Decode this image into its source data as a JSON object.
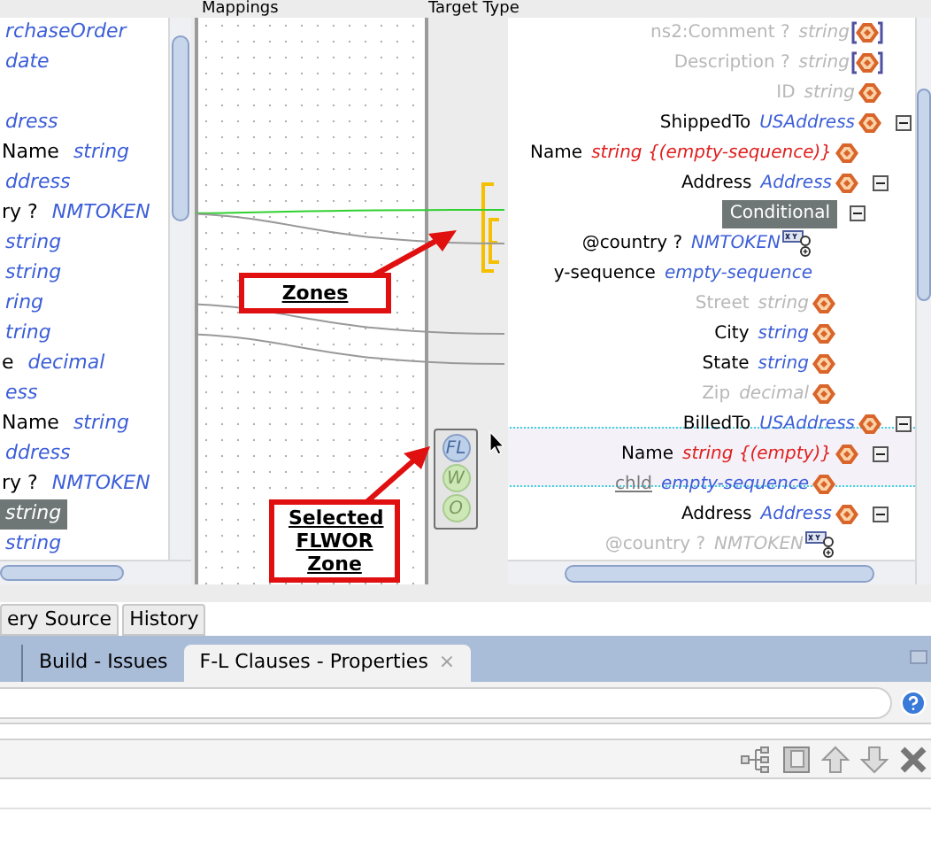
{
  "headers": {
    "mappings": "Mappings",
    "target": "Target Type"
  },
  "source_tree": [
    {
      "kind": "node",
      "type": "rchaseOrder",
      "selected": false
    },
    {
      "kind": "node",
      "type": "date",
      "selected": false
    },
    {
      "kind": "blank"
    },
    {
      "type": "dress",
      "selected": false
    },
    {
      "name": "Name",
      "type": "string",
      "selected": false
    },
    {
      "type": "ddress",
      "selected": false
    },
    {
      "name": "ry ?",
      "type": "NMTOKEN",
      "selected": false
    },
    {
      "type": "string",
      "selected": false
    },
    {
      "type": "string",
      "selected": false
    },
    {
      "type": "ring",
      "selected": false
    },
    {
      "type": "tring",
      "selected": false
    },
    {
      "name": "e",
      "type": "decimal",
      "selected": false
    },
    {
      "type": "ess",
      "selected": false
    },
    {
      "name": "Name",
      "type": "string",
      "selected": false
    },
    {
      "type": "ddress",
      "selected": false
    },
    {
      "name": "ry ?",
      "type": "NMTOKEN",
      "selected": false
    },
    {
      "type": "string",
      "selected": true
    },
    {
      "type": "string",
      "selected": false
    }
  ],
  "target_tree": [
    {
      "kind": "optional_element",
      "name": "ns2:Comment ?",
      "type": "string",
      "dimmed": true,
      "error": false
    },
    {
      "kind": "optional_element",
      "name": "Description ?",
      "type": "string",
      "dimmed": true,
      "error": false
    },
    {
      "kind": "element",
      "name": "ID",
      "type": "string",
      "dimmed": true,
      "error": false
    },
    {
      "kind": "element",
      "name": "ShippedTo",
      "type": "USAddress",
      "dimmed": false,
      "error": false,
      "expanded": true,
      "children": [
        {
          "kind": "element",
          "name": "Name",
          "type": "string {(empty-sequence)}",
          "dimmed": false,
          "error": true
        },
        {
          "kind": "element",
          "name": "Address",
          "type": "Address",
          "dimmed": false,
          "error": false,
          "expanded": true,
          "children": [
            {
              "kind": "conditional",
              "name": "Conditional",
              "expanded": true,
              "children": [
                {
                  "kind": "attribute",
                  "name": "@country ?",
                  "type": "NMTOKEN",
                  "dimmed": false,
                  "error": false
                },
                {
                  "kind": "sequence",
                  "name": "y-sequence",
                  "type": "empty-sequence",
                  "dimmed": false,
                  "error": false
                }
              ]
            },
            {
              "kind": "element",
              "name": "Street",
              "type": "string",
              "dimmed": true,
              "error": false
            },
            {
              "kind": "element",
              "name": "City",
              "type": "string",
              "dimmed": false,
              "error": false
            },
            {
              "kind": "element",
              "name": "State",
              "type": "string",
              "dimmed": false,
              "error": false
            },
            {
              "kind": "element",
              "name": "Zip",
              "type": "decimal",
              "dimmed": true,
              "error": false
            }
          ]
        }
      ]
    },
    {
      "kind": "element",
      "name": "BilledTo",
      "type": "USAddress",
      "dimmed": false,
      "error": false,
      "expanded": true,
      "children": [
        {
          "kind": "element",
          "name": "Name",
          "type": "string {(empty)}",
          "dimmed": false,
          "error": true,
          "expanded": true,
          "children": [
            {
              "kind": "variable",
              "name": "chld",
              "type": "empty-sequence",
              "dimmed": false,
              "error": false
            }
          ]
        },
        {
          "kind": "element",
          "name": "Address",
          "type": "Address",
          "dimmed": false,
          "error": false,
          "expanded": true,
          "children": [
            {
              "kind": "attribute",
              "name": "@country ?",
              "type": "NMTOKEN",
              "dimmed": true,
              "error": false
            }
          ]
        }
      ]
    }
  ],
  "zones": [
    {
      "kind": "conditional",
      "selected": false
    },
    {
      "kind": "flwor",
      "selected": true,
      "buttons": [
        {
          "label": "FL",
          "selected": true
        },
        {
          "label": "W",
          "selected": false
        },
        {
          "label": "O",
          "selected": false
        }
      ]
    }
  ],
  "callouts": [
    "Zones",
    "Selected FLWOR Zone"
  ],
  "editor_tabs": [
    "ery Source",
    "History"
  ],
  "panel_tabs": [
    {
      "label": "Build - Issues",
      "selected": false,
      "closable": false
    },
    {
      "label": "F-L Clauses - Properties",
      "selected": true,
      "closable": true
    }
  ],
  "close_glyph": "×"
}
